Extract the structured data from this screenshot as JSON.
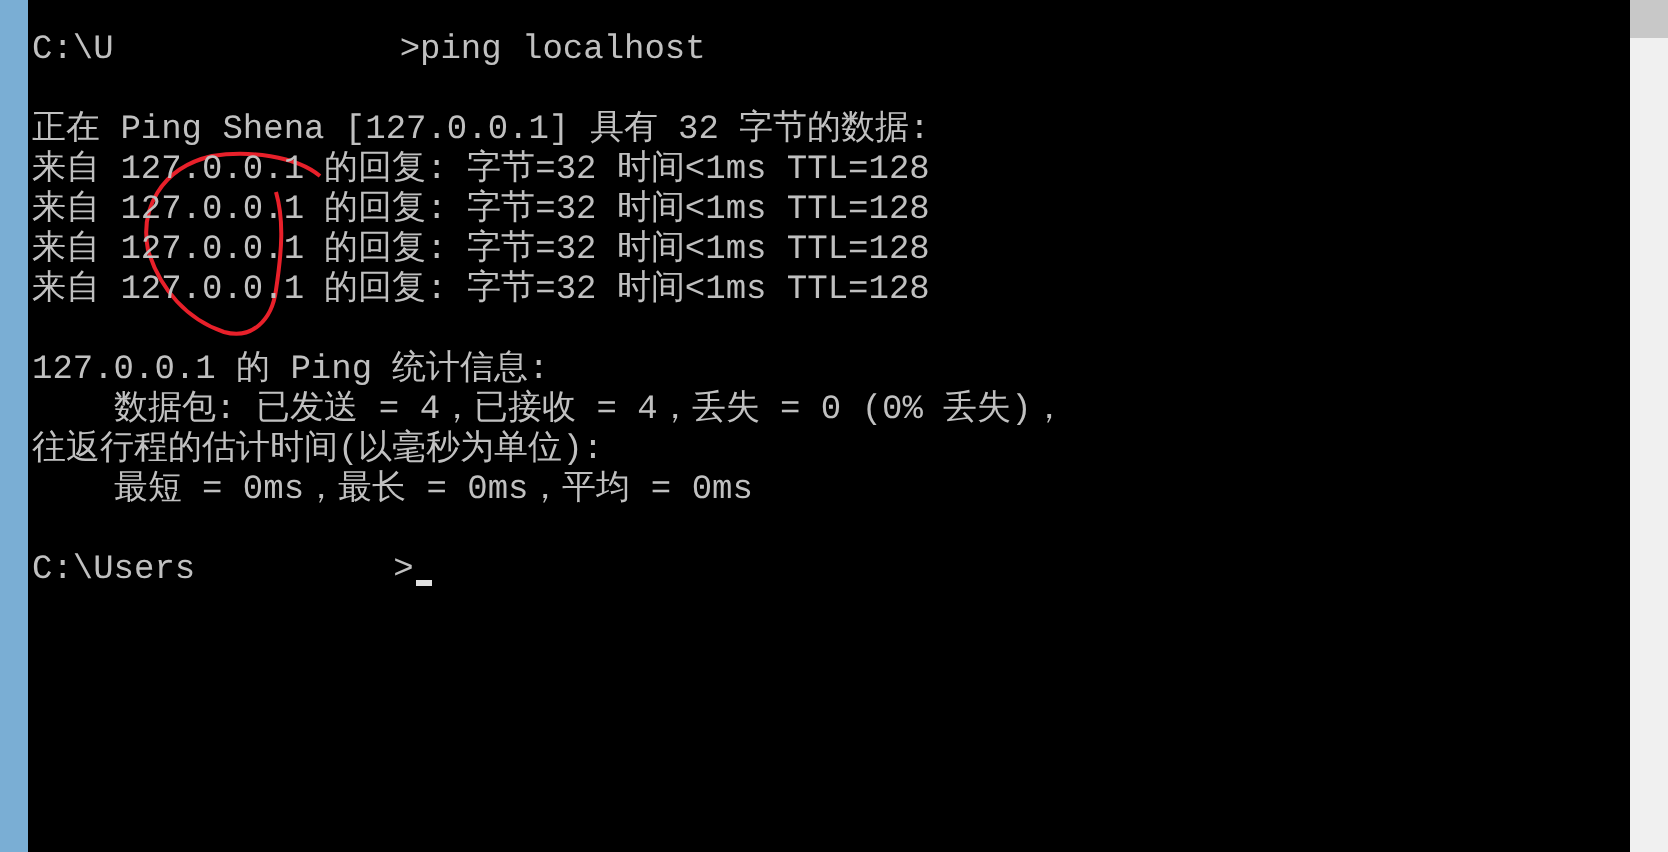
{
  "console": {
    "blocks": [
      {
        "lines": [
          {
            "kind": "prompt",
            "path": "C:\\U",
            "command": ">ping localhost"
          }
        ]
      },
      {
        "lines": [
          {
            "kind": "output",
            "text": "正在 Ping Shena [127.0.0.1] 具有 32 字节的数据:"
          },
          {
            "kind": "output",
            "text": "来自 127.0.0.1 的回复: 字节=32 时间<1ms TTL=128"
          },
          {
            "kind": "output",
            "text": "来自 127.0.0.1 的回复: 字节=32 时间<1ms TTL=128"
          },
          {
            "kind": "output",
            "text": "来自 127.0.0.1 的回复: 字节=32 时间<1ms TTL=128"
          },
          {
            "kind": "output",
            "text": "来自 127.0.0.1 的回复: 字节=32 时间<1ms TTL=128"
          }
        ]
      },
      {
        "lines": [
          {
            "kind": "output",
            "text": "127.0.0.1 的 Ping 统计信息:"
          },
          {
            "kind": "output",
            "text": "    数据包: 已发送 = 4，已接收 = 4，丢失 = 0 (0% 丢失)，"
          },
          {
            "kind": "output",
            "text": "往返行程的估计时间(以毫秒为单位):"
          },
          {
            "kind": "output",
            "text": "    最短 = 0ms，最长 = 0ms，平均 = 0ms"
          }
        ]
      },
      {
        "lines": [
          {
            "kind": "prompt",
            "path": "C:\\Users",
            "command": ">",
            "cursor": true
          }
        ]
      }
    ]
  }
}
